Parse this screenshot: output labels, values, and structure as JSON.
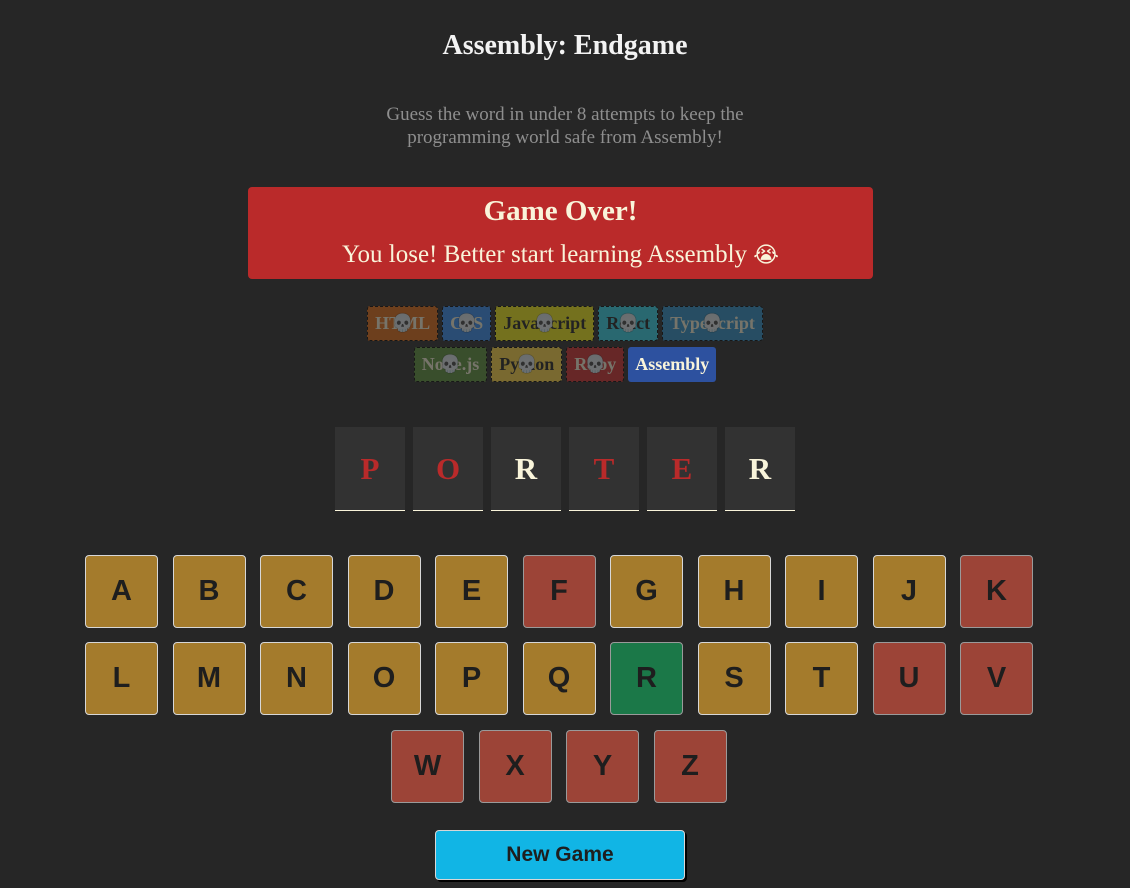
{
  "header": {
    "title": "Assembly: Endgame",
    "subtitle_line1": "Guess the word in under 8 attempts to keep the",
    "subtitle_line2": "programming world safe from Assembly!"
  },
  "status": {
    "title": "Game Over!",
    "message": "You lose! Better start learning Assembly",
    "emoji": "😭",
    "color": "#ba2a2a"
  },
  "languages": [
    {
      "name": "HTML",
      "bg": "#e2680f",
      "fg": "#f9f4da",
      "lost": true
    },
    {
      "name": "CSS",
      "bg": "#328af1",
      "fg": "#f9f4da",
      "lost": true
    },
    {
      "name": "JavaScript",
      "bg": "#f4eb13",
      "fg": "#1e1e1e",
      "lost": true
    },
    {
      "name": "React",
      "bg": "#2ed3e9",
      "fg": "#1e1e1e",
      "lost": true
    },
    {
      "name": "TypeScript",
      "bg": "#298ec6",
      "fg": "#f9f4da",
      "lost": true
    },
    {
      "name": "Node.js",
      "bg": "#599137",
      "fg": "#f9f4da",
      "lost": true
    },
    {
      "name": "Python",
      "bg": "#ffd742",
      "fg": "#1e1e1e",
      "lost": true
    },
    {
      "name": "Ruby",
      "bg": "#d02b2b",
      "fg": "#f9f4da",
      "lost": true
    },
    {
      "name": "Assembly",
      "bg": "#2d519f",
      "fg": "#f9f4da",
      "lost": false
    }
  ],
  "skull_icon": "💀",
  "word": {
    "letters": [
      {
        "char": "P",
        "state": "missed"
      },
      {
        "char": "O",
        "state": "missed"
      },
      {
        "char": "R",
        "state": "guessed"
      },
      {
        "char": "T",
        "state": "missed"
      },
      {
        "char": "E",
        "state": "missed"
      },
      {
        "char": "R",
        "state": "guessed"
      }
    ]
  },
  "keyboard": {
    "rows": [
      [
        "A",
        "B",
        "C",
        "D",
        "E",
        "F",
        "G",
        "H",
        "I",
        "J",
        "K"
      ],
      [
        "L",
        "M",
        "N",
        "O",
        "P",
        "Q",
        "R",
        "S",
        "T",
        "U",
        "V"
      ],
      [
        "W",
        "X",
        "Y",
        "Z"
      ]
    ],
    "wrong": [
      "F",
      "K",
      "U",
      "V",
      "W",
      "X",
      "Y",
      "Z"
    ],
    "correct": [
      "R"
    ],
    "colors": {
      "default": "#a47b2c",
      "wrong": "#9c4437",
      "correct": "#1b7848"
    }
  },
  "new_game_label": "New Game"
}
